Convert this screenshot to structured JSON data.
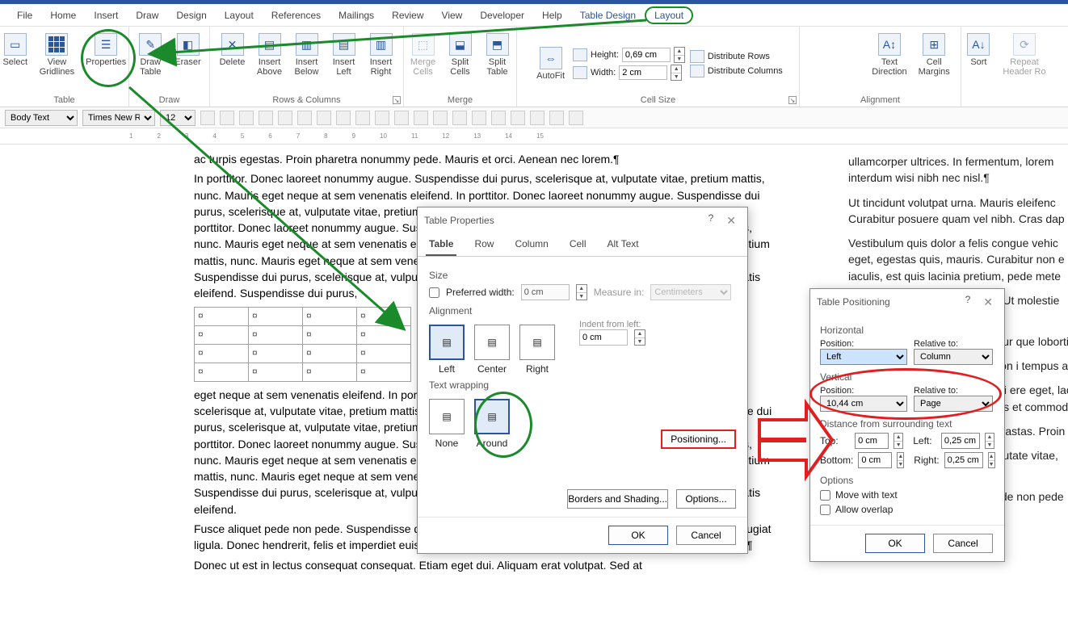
{
  "menubar": [
    "File",
    "Home",
    "Insert",
    "Draw",
    "Design",
    "Layout",
    "References",
    "Mailings",
    "Review",
    "View",
    "Developer",
    "Help",
    "Table Design",
    "Layout"
  ],
  "ribbon": {
    "table": {
      "label": "Table",
      "select": "Select",
      "gridlines": "View\nGridlines",
      "properties": "Properties"
    },
    "draw": {
      "label": "Draw",
      "drawtable": "Draw\nTable",
      "eraser": "Eraser"
    },
    "rows": {
      "label": "Rows & Columns",
      "delete": "Delete",
      "above": "Insert\nAbove",
      "below": "Insert\nBelow",
      "left": "Insert\nLeft",
      "right": "Insert\nRight"
    },
    "merge": {
      "label": "Merge",
      "merge": "Merge\nCells",
      "splitc": "Split\nCells",
      "splitt": "Split\nTable"
    },
    "cellsize": {
      "label": "Cell Size",
      "autofit": "AutoFit",
      "height_lbl": "Height:",
      "height_val": "0,69 cm",
      "width_lbl": "Width:",
      "width_val": "2 cm",
      "drows": "Distribute Rows",
      "dcols": "Distribute Columns"
    },
    "alignment": {
      "label": "Alignment",
      "textdir": "Text\nDirection",
      "cellmarg": "Cell\nMargins"
    },
    "data": {
      "label": "",
      "sort": "Sort",
      "repeat": "Repeat\nHeader Ro"
    }
  },
  "qat": {
    "style": "Body Text",
    "font": "Times New R",
    "size": "12"
  },
  "doc": {
    "p1": "ac turpis egestas. Proin pharetra nonummy pede. Mauris et orci. Aenean nec lorem.",
    "p2": "In porttitor. Donec laoreet nonummy augue. Suspendisse dui purus, scelerisque at, vulputate vitae, pretium mattis, nunc. Mauris eget neque at sem venenatis eleifend. In porttitor. Donec laoreet nonummy augue. Suspendisse dui purus, scelerisque at, vulputate vitae, pretium mattis, nunc. Mauris eget neque at sem venenatis eleifend. In porttitor. Donec laoreet nonummy augue. Suspendisse dui purus, scelerisque at, vulputate vitae, pretium mattis, nunc. Mauris eget neque at sem venenatis eleifend. Suspendisse dui purus, scelerisque at, vulputate vitae, pretium mattis, nunc. Mauris eget neque at sem venenatis eleifend. In porttitor. Donec laoreet nonummy augue. Suspendisse dui purus, scelerisque at, vulputate vitae, pretium mattis, nunc. Mauris eget neque at sem venenatis eleifend. Suspendisse dui purus,",
    "cell": "¤",
    "p3": "eget neque at sem venenatis eleifend. In porttitor. Donec laoreet nonummy augue. Suspendisse dui purus, scelerisque at, vulputate vitae, pretium mattis, nunc. Mauris eget neque at sem venenatis eleifend. Suspendisse dui purus, scelerisque at, vulputate vitae, pretium mattis, nunc. Mauris eget neque at sem venenatis eleifend. In porttitor. Donec laoreet nonummy augue. Suspendisse dui purus, scelerisque at, vulputate vitae, pretium mattis, nunc. Mauris eget neque at sem venenatis eleifend. Suspendisse dui purus, scelerisque at, vulputate vitae, pretium mattis, nunc. Mauris eget neque at sem venenatis eleifend. In porttitor. Donec laoreet nonummy augue. Suspendisse dui purus, scelerisque at, vulputate vitae, pretium mattis, nunc. Mauris eget neque at sem venenatis eleifend.",
    "p4": "Fusce aliquet pede non pede. Suspendisse dapibus lorem pellentesque magna. Integer nulla. Donec blandit feugiat ligula. Donec hendrerit, felis et imperdiet euismod, purus ipsum pretium metus, in lacinia nulla nisl eget sapien.",
    "p5": "Donec ut est in lectus consequat consequat. Etiam eget dui. Aliquam erat volutpat. Sed at",
    "c1": "ullamcorper ultrices. In fermentum, lorem interdum wisi nibh nec nisl.",
    "c2": "Ut tincidunt volutpat urna. Mauris eleifenc Curabitur posuere quam vel nibh. Cras dap",
    "c3": "Vestibulum quis dolor a felis congue vehic eget, egestas quis, mauris. Curabitur non e iaculis, est quis lacinia pretium, pede mete",
    "c4": "Quisque ornare placerat risus. Ut molestie nec sagittis.",
    "c5": "Duis pretiur que lobortis",
    "c6": "augue, ven ique ac, con i tempus an",
    "c7": "st. Suspendi massa, molli ere eget, laci ugue. Lorer e massa. Fus et commodo",
    "c8": "ellentesque astas. Proin p",
    "c9": "Donec laor scelerisque at, vulputate vitae, pretium ma eleifend.",
    "c10": "Ut nonummy. Fusce aliquet pede non pede blandit feugiat ligula"
  },
  "dlg_props": {
    "title": "Table Properties",
    "tabs": [
      "Table",
      "Row",
      "Column",
      "Cell",
      "Alt Text"
    ],
    "size": "Size",
    "prefw": "Preferred width:",
    "prefw_val": "0 cm",
    "measure": "Measure in:",
    "measure_val": "Centimeters",
    "alignment": "Alignment",
    "left": "Left",
    "center": "Center",
    "right": "Right",
    "indent": "Indent from left:",
    "indent_val": "0 cm",
    "wrap": "Text wrapping",
    "none": "None",
    "around": "Around",
    "positioning": "Positioning...",
    "borders": "Borders and Shading...",
    "options": "Options...",
    "ok": "OK",
    "cancel": "Cancel"
  },
  "dlg_pos": {
    "title": "Table Positioning",
    "horiz": "Horizontal",
    "pos": "Position:",
    "rel": "Relative to:",
    "h_pos": "Left",
    "h_rel": "Column",
    "vert": "Vertical",
    "v_pos": "10,44 cm",
    "v_rel": "Page",
    "dist": "Distance from surrounding text",
    "top": "Top:",
    "top_v": "0 cm",
    "left": "Left:",
    "left_v": "0,25 cm",
    "bottom": "Bottom:",
    "bottom_v": "0 cm",
    "right": "Right:",
    "right_v": "0,25 cm",
    "options": "Options",
    "move": "Move with text",
    "overlap": "Allow overlap",
    "ok": "OK",
    "cancel": "Cancel"
  }
}
